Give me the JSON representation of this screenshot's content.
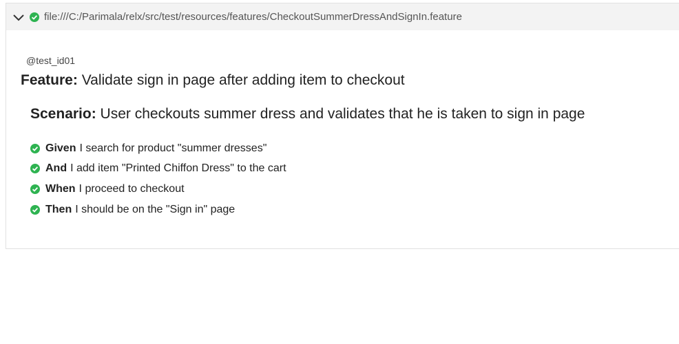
{
  "header": {
    "path": "file:///C:/Parimala/relx/src/test/resources/features/CheckoutSummerDressAndSignIn.feature",
    "status_color": "#2eb351"
  },
  "feature": {
    "tag": "@test_id01",
    "keyword": "Feature:",
    "title": "Validate sign in page after adding item to checkout"
  },
  "scenario": {
    "keyword": "Scenario:",
    "title": "User checkouts summer dress and validates that he is taken to sign in page"
  },
  "steps": [
    {
      "keyword": "Given",
      "text": "I search for product \"summer dresses\"",
      "status": "passed"
    },
    {
      "keyword": "And",
      "text": "I add item \"Printed Chiffon Dress\" to the cart",
      "status": "passed"
    },
    {
      "keyword": "When",
      "text": "I proceed to checkout",
      "status": "passed"
    },
    {
      "keyword": "Then",
      "text": "I should be on the \"Sign in\" page",
      "status": "passed"
    }
  ]
}
